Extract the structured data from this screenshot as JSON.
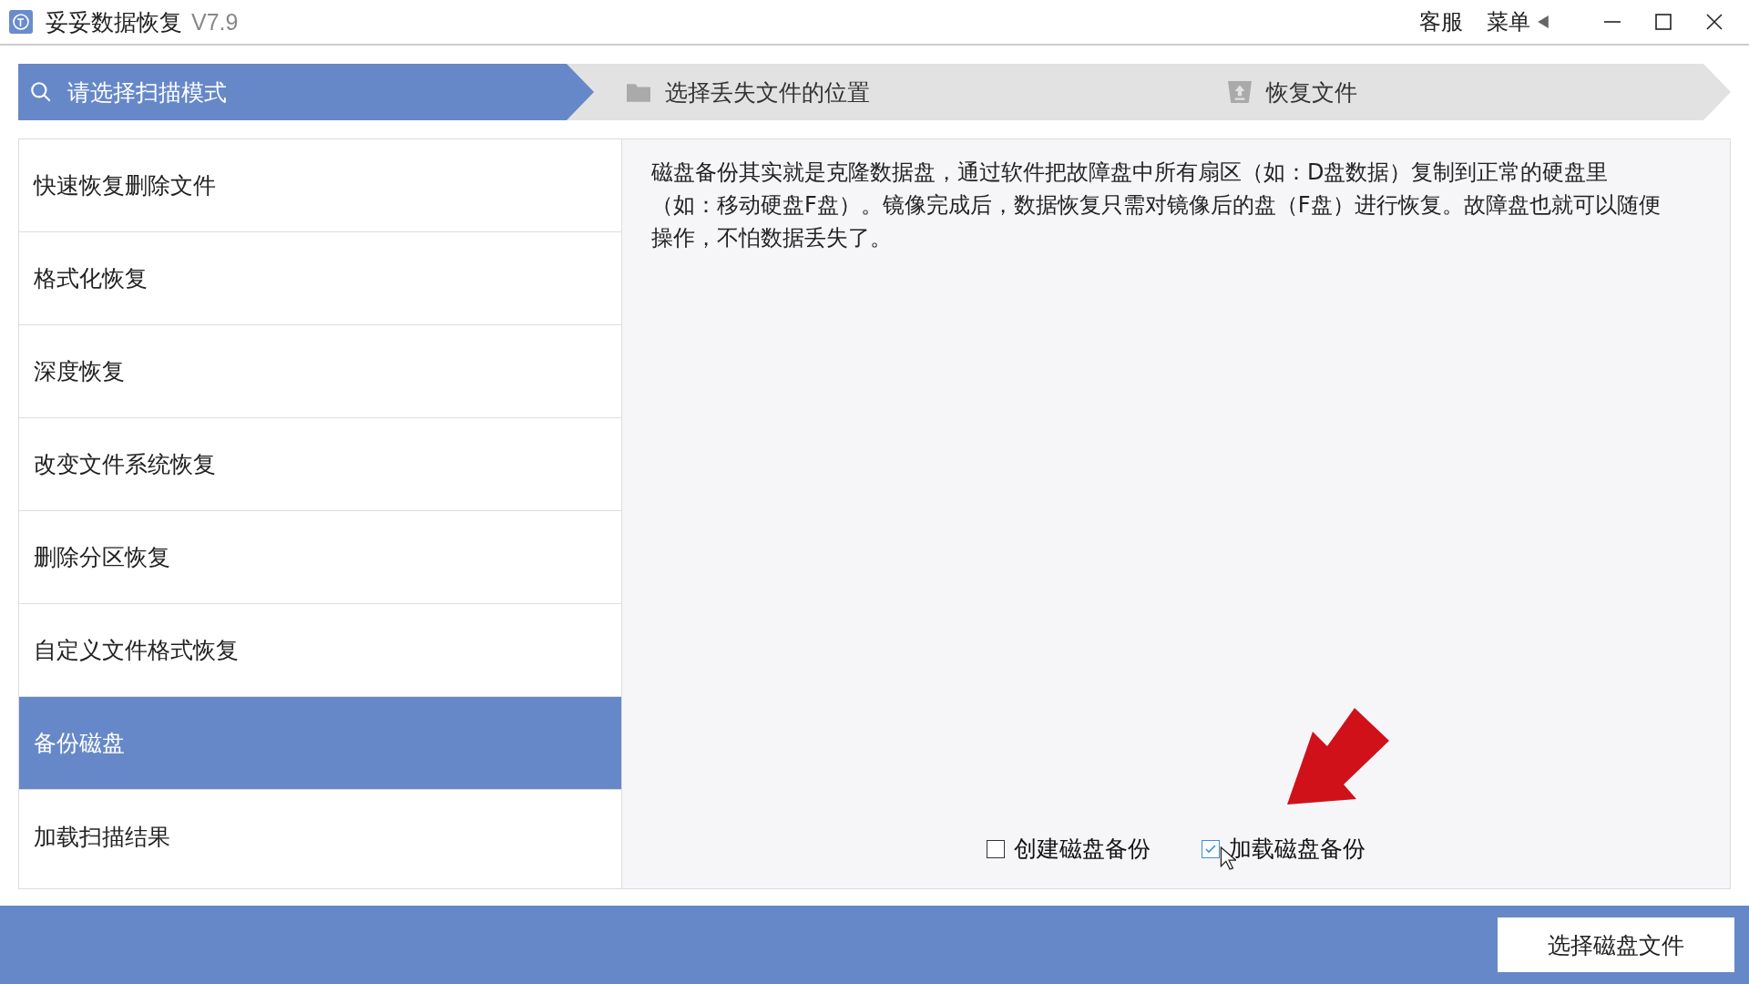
{
  "window": {
    "title": "妥妥数据恢复",
    "version": "V7.9",
    "links": [
      "客服",
      "菜单"
    ]
  },
  "steps": [
    {
      "label": "请选择扫描模式",
      "kind": "search",
      "selected": true
    },
    {
      "label": "选择丢失文件的位置",
      "kind": "folder",
      "selected": false
    },
    {
      "label": "恢复文件",
      "kind": "upload",
      "selected": false
    }
  ],
  "modes": [
    {
      "label": "快速恢复删除文件",
      "selected": false
    },
    {
      "label": "格式化恢复",
      "selected": false
    },
    {
      "label": "深度恢复",
      "selected": false
    },
    {
      "label": "改变文件系统恢复",
      "selected": false
    },
    {
      "label": "删除分区恢复",
      "selected": false
    },
    {
      "label": "自定义文件格式恢复",
      "selected": false
    },
    {
      "label": "备份磁盘",
      "selected": true
    },
    {
      "label": "加载扫描结果",
      "selected": false
    }
  ],
  "description": "磁盘备份其实就是克隆数据盘，通过软件把故障盘中所有扇区（如：D盘数据）复制到正常的硬盘里（如：移动硬盘F盘）。镜像完成后，数据恢复只需对镜像后的盘（F盘）进行恢复。故障盘也就可以随便操作，不怕数据丢失了。",
  "options": [
    {
      "label": "创建磁盘备份",
      "checked": false
    },
    {
      "label": "加载磁盘备份",
      "checked": true
    }
  ],
  "footer": {
    "button": "选择磁盘文件"
  }
}
